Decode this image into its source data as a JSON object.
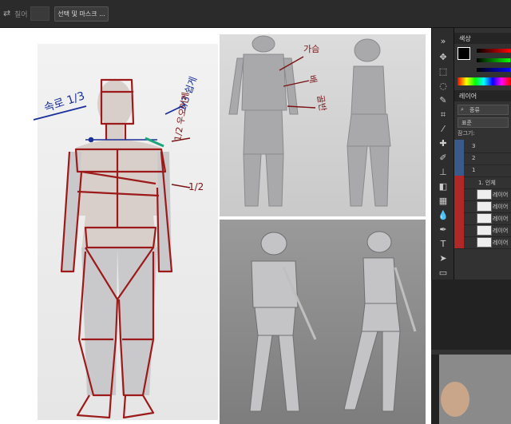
{
  "options_bar": {
    "feather_label": "칠어",
    "select_mask_button": "선택 및 마스크 ..."
  },
  "annotations": {
    "shoulder": "속로 1/3",
    "shoulder_right": "1/3 쉽게",
    "chest_mark": "1/2 우오어께",
    "waist_mark": "1/2",
    "chest_label": "가슴",
    "waist_label": "배",
    "pelvis_label": "골반"
  },
  "panels": {
    "color_tab": "색상",
    "layers_tab": "레이어",
    "kind_label": "종류",
    "blend_mode": "표준",
    "lock_label": "잠그기:",
    "layers": [
      {
        "name": "3",
        "type": "group"
      },
      {
        "name": "2",
        "type": "group"
      },
      {
        "name": "1",
        "type": "group"
      },
      {
        "name": "1. 인체",
        "type": "text"
      },
      {
        "name": "레이어",
        "type": "pixel"
      },
      {
        "name": "레이어",
        "type": "pixel"
      },
      {
        "name": "레이어",
        "type": "pixel"
      },
      {
        "name": "레이어",
        "type": "pixel"
      },
      {
        "name": "레이어",
        "type": "pixel"
      }
    ]
  },
  "colors": {
    "accent_red": "#b02727",
    "annotation_blue": "#1a2f9a",
    "annotation_maroon": "#7a1414"
  }
}
